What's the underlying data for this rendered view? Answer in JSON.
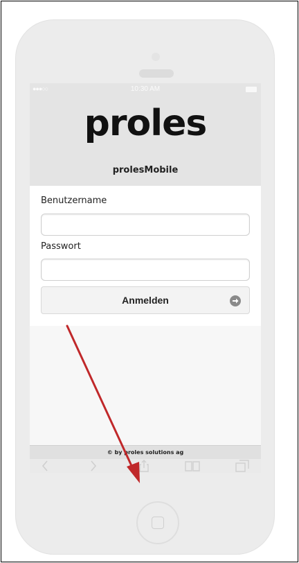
{
  "status_bar": {
    "carrier": "●●●○○",
    "time": "10:30 AM"
  },
  "header": {
    "logo": "proles",
    "subtitle": "prolesMobile"
  },
  "login_form": {
    "username_label": "Benutzername",
    "username_value": "",
    "password_label": "Passwort",
    "password_value": "",
    "submit_label": "Anmelden"
  },
  "footer": {
    "copyright": "© by proles solutions ag"
  },
  "toolbar": {
    "icons": [
      "back-icon",
      "forward-icon",
      "share-icon",
      "bookmarks-icon",
      "tabs-icon"
    ]
  },
  "annotation": {
    "arrow_color": "#c0282a"
  },
  "colors": {
    "accent": "#c0282a"
  }
}
